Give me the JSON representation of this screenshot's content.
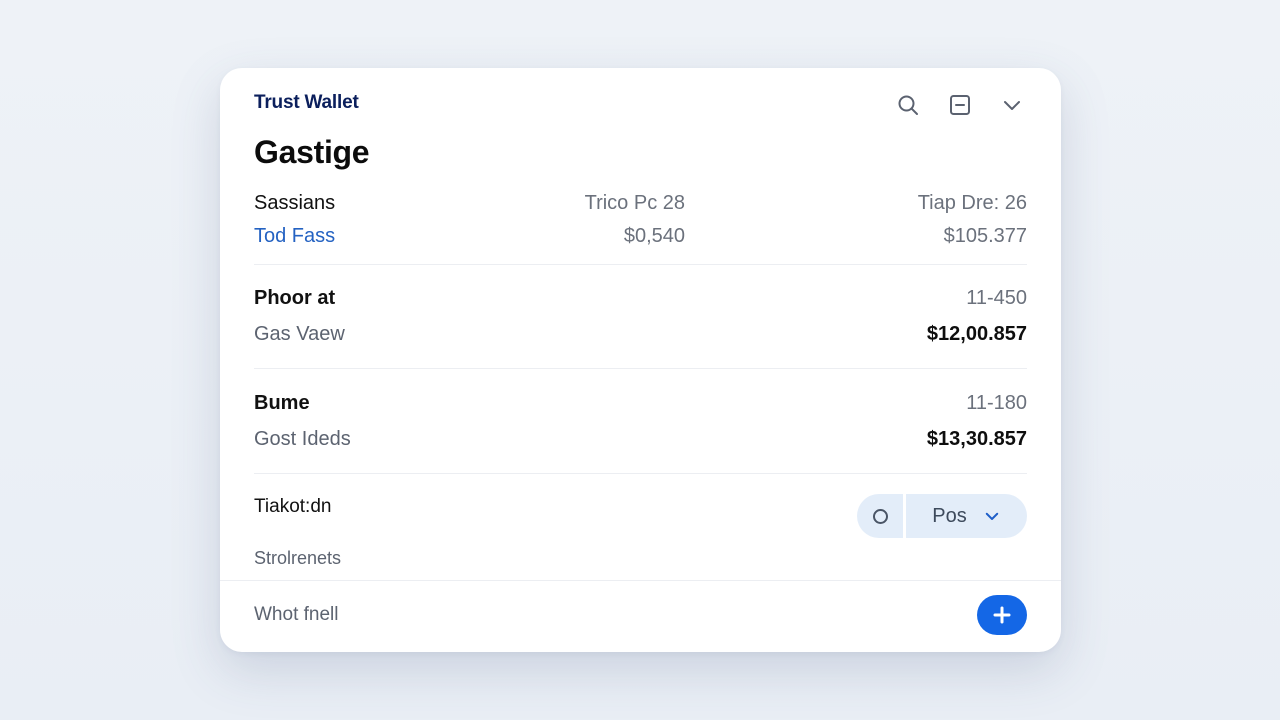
{
  "brand": "Trust Wallet",
  "page_title": "Gastige",
  "header_icons": [
    "search-icon",
    "minimize-icon",
    "chevron-down-icon"
  ],
  "summary": {
    "left_label": "Sassians",
    "left_link": "Tod Fass",
    "col2_label": "Trico Pc 28",
    "col2_value": "$0,540",
    "col3_label": "Tiap Dre: 26",
    "col3_value": "$105.377"
  },
  "items": [
    {
      "name": "Phoor at",
      "sub": "Gas Vaew",
      "code": "11-450",
      "amount": "$12,00.857"
    },
    {
      "name": "Bume",
      "sub": "Gost Ideds",
      "code": "11-180",
      "amount": "$13,30.857"
    }
  ],
  "settings": {
    "label": "Tiakot:dn",
    "sub_label": "Strolrenets",
    "pill_value": "Pos"
  },
  "footer": {
    "label": "Whot fnell",
    "add_icon": "plus-icon"
  },
  "colors": {
    "brand": "#0b1f5c",
    "link": "#2462c2",
    "accent": "#1467e6",
    "pill_bg": "#e3edf9"
  }
}
